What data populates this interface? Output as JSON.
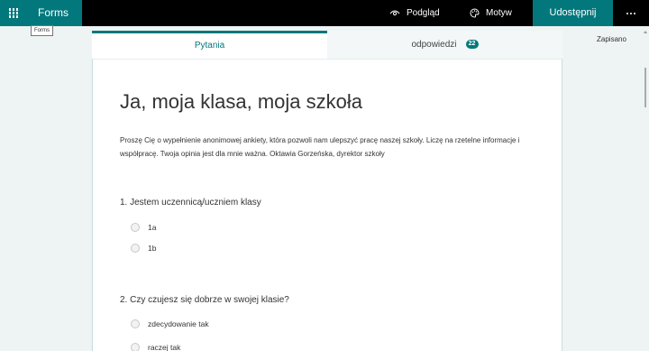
{
  "app": {
    "name": "Forms",
    "tooltip": "Forms",
    "preview_label": "Podgląd",
    "theme_label": "Motyw",
    "share_label": "Udostępnij",
    "saved_status": "Zapisano"
  },
  "tabs": {
    "questions_label": "Pytania",
    "responses_label": "odpowiedzi",
    "responses_count": "22"
  },
  "form": {
    "title": "Ja, moja klasa, moja szkoła",
    "description": "Proszę Cię o wypełnienie anonimowej ankiety, która pozwoli nam ulepszyć  pracę naszej szkoły. Liczę na rzetelne informacje i współpracę. Twoja opinia jest dla mnie ważna. Oktawia Gorzeńska, dyrektor szkoły",
    "questions": [
      {
        "text": "1. Jestem uczennicą/uczniem klasy",
        "options": [
          "1a",
          "1b"
        ]
      },
      {
        "text": "2. Czy czujesz się dobrze w swojej klasie?",
        "options": [
          "zdecydowanie tak",
          "raczej tak"
        ]
      }
    ]
  },
  "colors": {
    "accent": "#03787c",
    "topbar": "#000000",
    "background": "#eef3f3"
  }
}
